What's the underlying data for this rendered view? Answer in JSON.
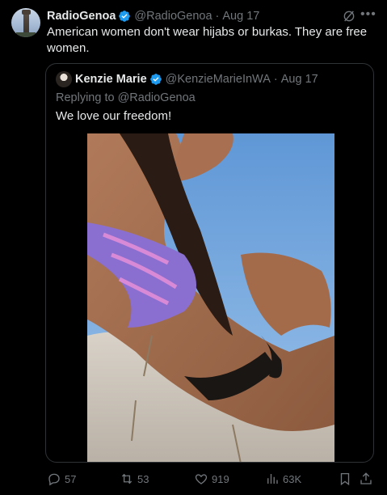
{
  "tweet": {
    "author_name": "RadioGenoa",
    "author_handle": "@RadioGenoa",
    "separator": "·",
    "date": "Aug 17",
    "text": "American women don't wear hijabs or burkas. They are free women.",
    "avatar_icon": "tower-avatar",
    "more_icon": "more-horizontal-icon",
    "grok_icon": "grok-icon"
  },
  "quote": {
    "author_name": "Kenzie Marie",
    "author_handle": "@KenzieMarieInWA",
    "separator": "·",
    "date": "Aug 17",
    "replying_to": "Replying to @RadioGenoa",
    "text": "We love our freedom!",
    "photo_icon": "beach-photo"
  },
  "actions": {
    "replies": "57",
    "reposts": "53",
    "likes": "919",
    "views": "63K"
  },
  "colors": {
    "background": "#000000",
    "text": "#e7e9ea",
    "muted": "#71767b",
    "border": "#2f3336",
    "verified": "#1d9bf0"
  }
}
